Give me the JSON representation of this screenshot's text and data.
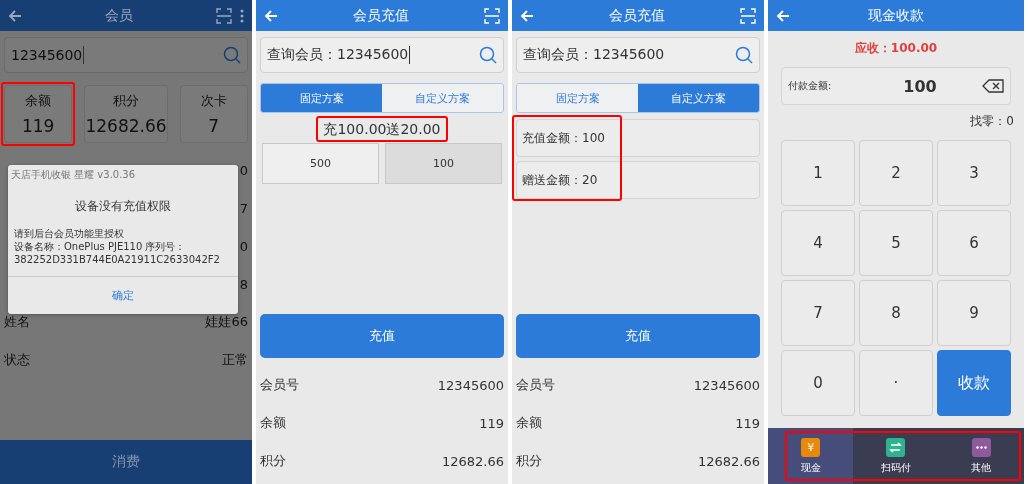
{
  "member_screen": {
    "title": "会员",
    "search": {
      "value": "12345600"
    },
    "stats": [
      {
        "label": "余额",
        "value": "119",
        "highlighted": true
      },
      {
        "label": "积分",
        "value": "12682.66",
        "highlighted": false
      },
      {
        "label": "次卡",
        "value": "7",
        "highlighted": false
      }
    ],
    "rows": [
      {
        "value": "0"
      },
      {
        "value": "7"
      },
      {
        "value": "0"
      },
      {
        "value": "8"
      },
      {
        "label": "姓名",
        "value": "娃娃66"
      },
      {
        "label": "状态",
        "value": "正常"
      }
    ],
    "bottom_button": "消费",
    "dialog": {
      "app_name": "天店手机收银 星耀 v3.0.36",
      "title": "设备没有充值权限",
      "lines": [
        "请到后台会员功能里授权",
        "设备名称：OnePlus PJE110  序列号：",
        "382252D331B744E0A21911C2633042F2"
      ],
      "button": "确定"
    }
  },
  "recharge_fixed_screen": {
    "title": "会员充值",
    "search": {
      "value": "查询会员：12345600"
    },
    "tabs": [
      {
        "label": "固定方案",
        "selected": true
      },
      {
        "label": "自定义方案",
        "selected": false
      }
    ],
    "plan": {
      "text": "充100.00送20.00",
      "highlighted": true
    },
    "options": [
      {
        "label": "500",
        "selected": false
      },
      {
        "label": "100",
        "selected": true
      }
    ],
    "submit": "充值",
    "rows": [
      {
        "label": "会员号",
        "value": "12345600"
      },
      {
        "label": "余额",
        "value": "119"
      },
      {
        "label": "积分",
        "value": "12682.66"
      }
    ]
  },
  "recharge_custom_screen": {
    "title": "会员充值",
    "search": {
      "value": "查询会员：12345600"
    },
    "tabs": [
      {
        "label": "固定方案",
        "selected": false
      },
      {
        "label": "自定义方案",
        "selected": true
      }
    ],
    "fields_highlighted": true,
    "fields": [
      {
        "value": "充值金额：100"
      },
      {
        "value": "赠送金额：20"
      }
    ],
    "submit": "充值",
    "rows": [
      {
        "label": "会员号",
        "value": "12345600"
      },
      {
        "label": "余额",
        "value": "119"
      },
      {
        "label": "积分",
        "value": "12682.66"
      }
    ]
  },
  "cash_screen": {
    "title": "现金收款",
    "due": "应收：100.00",
    "payment": {
      "label": "付款金额:",
      "value": "100"
    },
    "change": "找零：0",
    "keys": [
      {
        "label": "1",
        "kind": "digit"
      },
      {
        "label": "2",
        "kind": "digit"
      },
      {
        "label": "3",
        "kind": "digit"
      },
      {
        "label": "4",
        "kind": "digit"
      },
      {
        "label": "5",
        "kind": "digit"
      },
      {
        "label": "6",
        "kind": "digit"
      },
      {
        "label": "7",
        "kind": "digit"
      },
      {
        "label": "8",
        "kind": "digit"
      },
      {
        "label": "9",
        "kind": "digit"
      },
      {
        "label": "0",
        "kind": "digit"
      },
      {
        "label": "·",
        "kind": "digit"
      },
      {
        "label": "收款",
        "kind": "submit"
      }
    ],
    "pay_methods_highlighted": true,
    "pay_methods": [
      {
        "label": "现金",
        "glyph": "¥",
        "color": "#e8890c",
        "selected": true
      },
      {
        "label": "扫码付",
        "color": "#2fb38f",
        "selected": false
      },
      {
        "label": "其他",
        "color": "#8e5a9c",
        "selected": false
      }
    ]
  }
}
